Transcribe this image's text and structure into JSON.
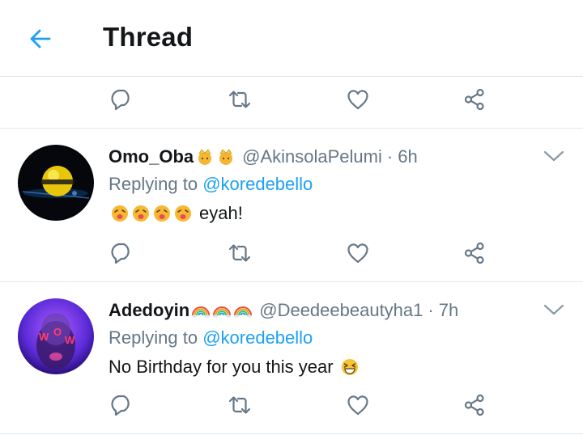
{
  "header": {
    "title": "Thread"
  },
  "colors": {
    "accent": "#1da1f2",
    "secondary_text": "#657786",
    "divider": "#e1e8ed"
  },
  "tweets": [
    {
      "display_name": "Omo_Oba",
      "name_emojis": [
        "princess-emoji",
        "princess-emoji"
      ],
      "handle": "@AkinsolaPelumi",
      "separator": "·",
      "time": "6h",
      "replying_prefix": "Replying to",
      "replying_to": "@koredebello",
      "text_emojis": [
        "face-with-tongue-emoji",
        "face-with-tongue-emoji",
        "face-with-tongue-emoji",
        "face-with-tongue-emoji"
      ],
      "text": "eyah!"
    },
    {
      "display_name": "Adedoyin",
      "name_emojis": [
        "rainbow-emoji",
        "rainbow-emoji",
        "rainbow-emoji"
      ],
      "handle": "@Deedeebeautyha1",
      "separator": "·",
      "time": "7h",
      "replying_prefix": "Replying to",
      "replying_to": "@koredebello",
      "text": "No Birthday for you this year",
      "text_emojis": [
        "grinning-squinting-face-emoji"
      ]
    }
  ],
  "icons": {
    "back": "arrow-left-icon",
    "reply": "reply-icon",
    "retweet": "retweet-icon",
    "like": "heart-icon",
    "share": "share-icon",
    "more": "chevron-down-icon"
  }
}
